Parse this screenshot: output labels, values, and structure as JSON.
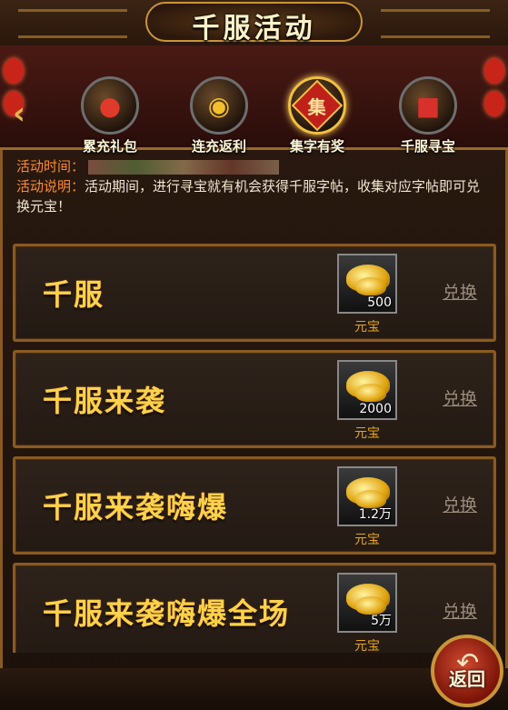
{
  "header": {
    "title": "千服活动"
  },
  "tabs": [
    {
      "label": "累充礼包",
      "icon": "gift-bag-icon"
    },
    {
      "label": "连充返利",
      "icon": "gold-coins-icon"
    },
    {
      "label": "集字有奖",
      "icon": "seal-icon",
      "seal_char": "集",
      "active": true
    },
    {
      "label": "千服寻宝",
      "icon": "treasure-chest-icon"
    }
  ],
  "info": {
    "time_label": "活动时间：",
    "desc_label": "活动说明：",
    "desc_text": "活动期间，进行寻宝就有机会获得千服字帖，收集对应字帖即可兑换元宝！"
  },
  "rows": [
    {
      "name": "千服",
      "qty": "500",
      "item": "元宝",
      "action": "兑换"
    },
    {
      "name": "千服来袭",
      "qty": "2000",
      "item": "元宝",
      "action": "兑换"
    },
    {
      "name": "千服来袭嗨爆",
      "qty": "1.2万",
      "item": "元宝",
      "action": "兑换"
    },
    {
      "name": "千服来袭嗨爆全场",
      "qty": "5万",
      "item": "元宝",
      "action": "兑换"
    }
  ],
  "return_button": {
    "label": "返回"
  },
  "colors": {
    "gold": "#ffd24a",
    "frame": "#8a5a22",
    "label_orange": "#ff8a2a"
  }
}
